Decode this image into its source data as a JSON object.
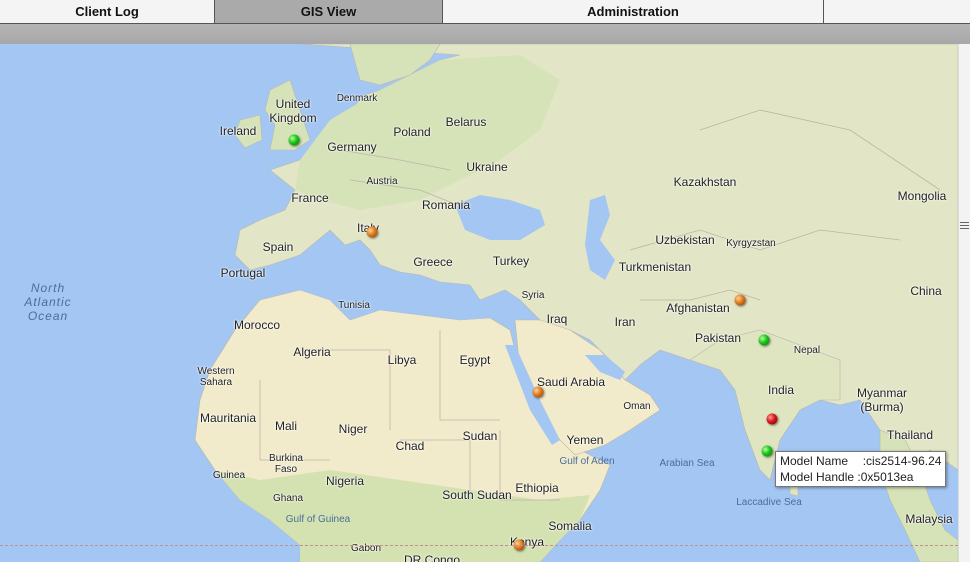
{
  "tabs": [
    {
      "label": "Client Log",
      "active": false
    },
    {
      "label": "GIS View",
      "active": true
    },
    {
      "label": "Administration",
      "active": false
    },
    {
      "label": "",
      "active": false
    }
  ],
  "map": {
    "labels": {
      "united_kingdom": "United\nKingdom",
      "ireland": "Ireland",
      "denmark": "Denmark",
      "poland": "Poland",
      "belarus": "Belarus",
      "germany": "Germany",
      "ukraine": "Ukraine",
      "austria": "Austria",
      "france": "France",
      "romania": "Romania",
      "kazakhstan": "Kazakhstan",
      "mongolia": "Mongolia",
      "spain": "Spain",
      "italy": "Italy",
      "portugal": "Portugal",
      "greece": "Greece",
      "turkey": "Turkey",
      "uzbekistan": "Uzbekistan",
      "kyrgyzstan": "Kyrgyzstan",
      "turkmenistan": "Turkmenistan",
      "china": "China",
      "north_atlantic_ocean": "North\nAtlantic\nOcean",
      "syria": "Syria",
      "tunisia": "Tunisia",
      "afghanistan": "Afghanistan",
      "morocco": "Morocco",
      "iraq": "Iraq",
      "iran": "Iran",
      "pakistan": "Pakistan",
      "nepal": "Nepal",
      "algeria": "Algeria",
      "libya": "Libya",
      "egypt": "Egypt",
      "india": "India",
      "western_sahara": "Western\nSahara",
      "saudi_arabia": "Saudi Arabia",
      "oman": "Oman",
      "myanmar": "Myanmar\n(Burma)",
      "mauritania": "Mauritania",
      "mali": "Mali",
      "niger": "Niger",
      "chad": "Chad",
      "sudan": "Sudan",
      "yemen": "Yemen",
      "thailand": "Thailand",
      "burkina_faso": "Burkina\nFaso",
      "gulf_of_aden": "Gulf of Aden",
      "arabian_sea": "Arabian Sea",
      "guinea": "Guinea",
      "ghana": "Ghana",
      "nigeria": "Nigeria",
      "ethiopia": "Ethiopia",
      "south_sudan": "South Sudan",
      "laccadive_sea": "Laccadive Sea",
      "gulf_of_guinea": "Gulf of Guinea",
      "somalia": "Somalia",
      "malaysia": "Malaysia",
      "gabon": "Gabon",
      "kenya": "Kenya",
      "dr_congo": "DR Congo"
    },
    "markers": [
      {
        "status": "green",
        "color": "#18c418"
      },
      {
        "status": "orange",
        "color": "#e07a1c"
      },
      {
        "status": "orange",
        "color": "#e07a1c"
      },
      {
        "status": "green",
        "color": "#18c418"
      },
      {
        "status": "orange",
        "color": "#e07a1c"
      },
      {
        "status": "red",
        "color": "#d61414"
      },
      {
        "status": "green",
        "color": "#18c418"
      },
      {
        "status": "orange",
        "color": "#e07a1c"
      }
    ],
    "tooltip": {
      "model_name_label": "Model Name",
      "model_name_value": ":cis2514-96.24",
      "model_handle_label": "Model Handle",
      "model_handle_value": ":0x5013ea"
    }
  },
  "colors": {
    "water": "#a3c6f3",
    "land_north": "#e4e8c8",
    "land_desert": "#f3eccb",
    "land_green": "#cfe0b0",
    "active_tab": "#aaaaaa"
  }
}
